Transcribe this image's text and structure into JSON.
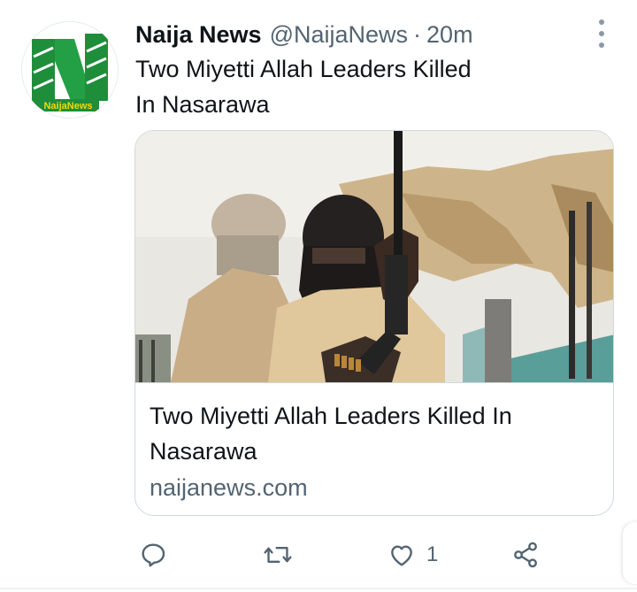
{
  "tweet": {
    "display_name": "Naija News",
    "handle": "@NaijaNews",
    "separator": "·",
    "time": "20m",
    "text_line1": "Two Miyetti Allah Leaders Killed",
    "text_line2": "In Nasarawa",
    "avatar_logo_text": "NaijaNews",
    "more_icon": "more-vertical-icon"
  },
  "card": {
    "title_line1": "Two Miyetti Allah Leaders Killed In",
    "title_line2": "Nasarawa",
    "domain": "naijanews.com",
    "image_alt": "Armed men with covered faces holding a rifle"
  },
  "actions": {
    "reply_icon": "reply-icon",
    "retweet_icon": "retweet-icon",
    "like_icon": "heart-icon",
    "like_count": "1",
    "share_icon": "share-icon"
  },
  "colors": {
    "text_primary": "#0f1419",
    "text_secondary": "#536471",
    "border": "#cfd9de",
    "brand_green": "#1f8f3a"
  }
}
